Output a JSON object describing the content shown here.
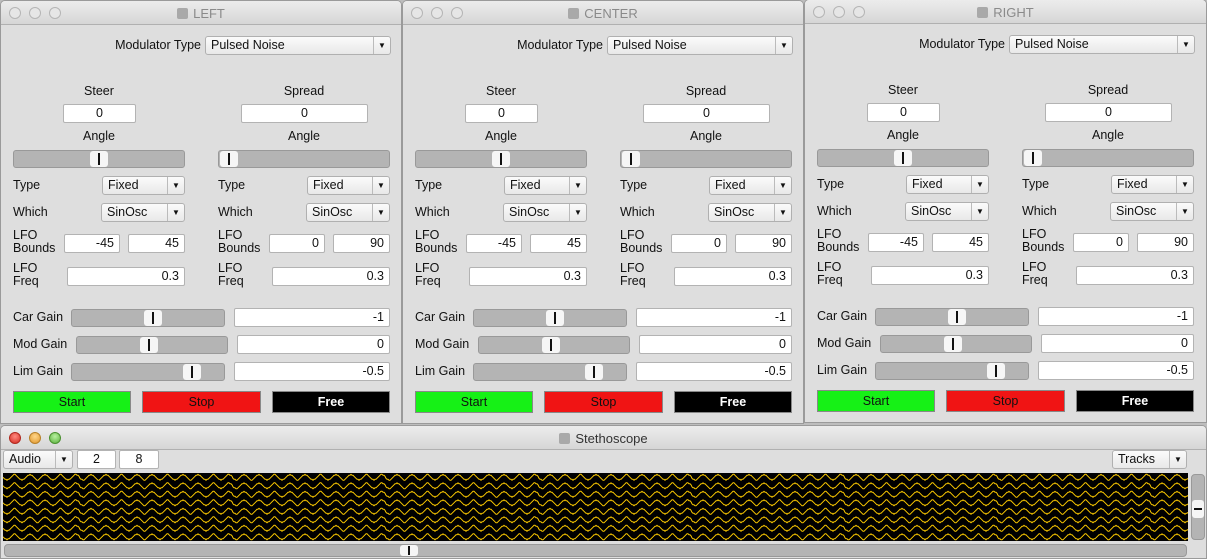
{
  "panels": [
    {
      "title": "LEFT",
      "modulator_label": "Modulator Type",
      "modulator_value": "Pulsed Noise",
      "steer": {
        "label": "Steer",
        "value": "0",
        "angle_label": "Angle",
        "angle_position": 0.5,
        "type_label": "Type",
        "type": "Fixed",
        "which_label": "Which",
        "which": "SinOsc",
        "bounds_label1": "LFO",
        "bounds_label2": "Bounds",
        "bounds_min": "-45",
        "bounds_max": "45",
        "freq_label1": "LFO",
        "freq_label2": "Freq",
        "freq": "0.3"
      },
      "spread": {
        "label": "Spread",
        "value": "0",
        "angle_label": "Angle",
        "angle_position": 0.06,
        "type_label": "Type",
        "type": "Fixed",
        "which_label": "Which",
        "which": "SinOsc",
        "bounds_label1": "LFO",
        "bounds_label2": "Bounds",
        "bounds_min": "0",
        "bounds_max": "90",
        "freq_label1": "LFO",
        "freq_label2": "Freq",
        "freq": "0.3"
      },
      "gains": [
        {
          "label": "Car Gain",
          "value": "-1",
          "position": 0.53
        },
        {
          "label": "Mod Gain",
          "value": "0",
          "position": 0.48
        },
        {
          "label": "Lim Gain",
          "value": "-0.5",
          "position": 0.79
        }
      ],
      "start": "Start",
      "stop": "Stop",
      "free": "Free"
    },
    {
      "title": "CENTER",
      "modulator_label": "Modulator Type",
      "modulator_value": "Pulsed Noise",
      "steer": {
        "label": "Steer",
        "value": "0",
        "angle_label": "Angle",
        "angle_position": 0.5,
        "type_label": "Type",
        "type": "Fixed",
        "which_label": "Which",
        "which": "SinOsc",
        "bounds_label1": "LFO",
        "bounds_label2": "Bounds",
        "bounds_min": "-45",
        "bounds_max": "45",
        "freq_label1": "LFO",
        "freq_label2": "Freq",
        "freq": "0.3"
      },
      "spread": {
        "label": "Spread",
        "value": "0",
        "angle_label": "Angle",
        "angle_position": 0.06,
        "type_label": "Type",
        "type": "Fixed",
        "which_label": "Which",
        "which": "SinOsc",
        "bounds_label1": "LFO",
        "bounds_label2": "Bounds",
        "bounds_min": "0",
        "bounds_max": "90",
        "freq_label1": "LFO",
        "freq_label2": "Freq",
        "freq": "0.3"
      },
      "gains": [
        {
          "label": "Car Gain",
          "value": "-1",
          "position": 0.53
        },
        {
          "label": "Mod Gain",
          "value": "0",
          "position": 0.48
        },
        {
          "label": "Lim Gain",
          "value": "-0.5",
          "position": 0.79
        }
      ],
      "start": "Start",
      "stop": "Stop",
      "free": "Free"
    },
    {
      "title": "RIGHT",
      "modulator_label": "Modulator Type",
      "modulator_value": "Pulsed Noise",
      "steer": {
        "label": "Steer",
        "value": "0",
        "angle_label": "Angle",
        "angle_position": 0.5,
        "type_label": "Type",
        "type": "Fixed",
        "which_label": "Which",
        "which": "SinOsc",
        "bounds_label1": "LFO",
        "bounds_label2": "Bounds",
        "bounds_min": "-45",
        "bounds_max": "45",
        "freq_label1": "LFO",
        "freq_label2": "Freq",
        "freq": "0.3"
      },
      "spread": {
        "label": "Spread",
        "value": "0",
        "angle_label": "Angle",
        "angle_position": 0.06,
        "type_label": "Type",
        "type": "Fixed",
        "which_label": "Which",
        "which": "SinOsc",
        "bounds_label1": "LFO",
        "bounds_label2": "Bounds",
        "bounds_min": "0",
        "bounds_max": "90",
        "freq_label1": "LFO",
        "freq_label2": "Freq",
        "freq": "0.3"
      },
      "gains": [
        {
          "label": "Car Gain",
          "value": "-1",
          "position": 0.53
        },
        {
          "label": "Mod Gain",
          "value": "0",
          "position": 0.48
        },
        {
          "label": "Lim Gain",
          "value": "-0.5",
          "position": 0.79
        }
      ],
      "start": "Start",
      "stop": "Stop",
      "free": "Free"
    }
  ],
  "colors": {
    "start": "#16f116",
    "stop": "#f01414",
    "free": "#000000",
    "trace": "#ffcc00",
    "scope_bg": "#000000"
  },
  "stethoscope": {
    "title": "Stethoscope",
    "rate": "Audio",
    "channel_offset": "2",
    "num_channels": "8",
    "view_mode": "Tracks",
    "vertical_scroll_position": 0.55,
    "horizontal_scroll_position": 0.34,
    "traces": 8
  }
}
